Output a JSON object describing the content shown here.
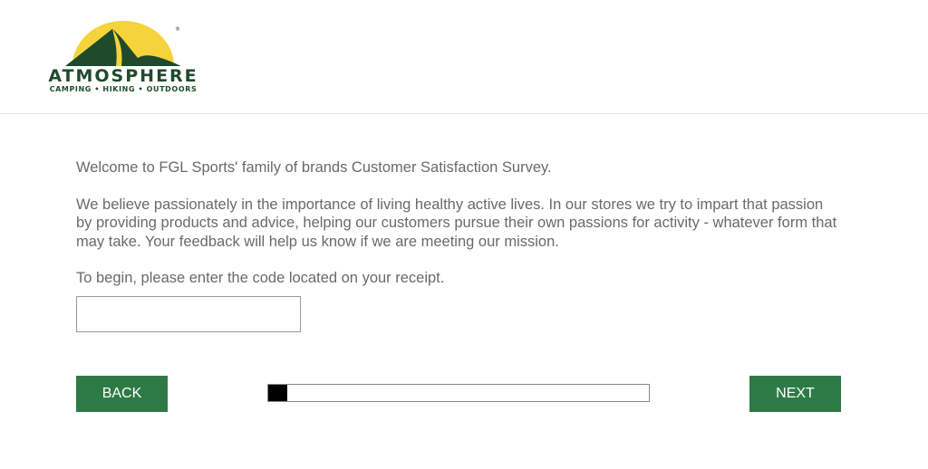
{
  "header": {
    "logo": {
      "name": "ATMOSPHERE",
      "tagline": "CAMPING • HIKING • OUTDOORS",
      "icon": "tent-mountain-logo-icon",
      "colors": {
        "sun": "#f5d33a",
        "mountain": "#1f4a2c",
        "text": "#1f4a2c"
      }
    }
  },
  "intro": {
    "welcome": "Welcome to FGL Sports' family of brands Customer Satisfaction Survey.",
    "mission": "We believe passionately in the importance of living healthy active lives. In our stores we try to impart that passion by providing products and advice, helping our customers pursue their own passions for activity - whatever form that may take. Your feedback will help us know if we are meeting our mission.",
    "instruction": "To begin, please enter the code located on your receipt."
  },
  "code_input": {
    "value": "",
    "placeholder": ""
  },
  "nav": {
    "back_label": "BACK",
    "next_label": "NEXT",
    "button_color": "#2e7a46"
  },
  "progress": {
    "fraction": 0.05
  }
}
